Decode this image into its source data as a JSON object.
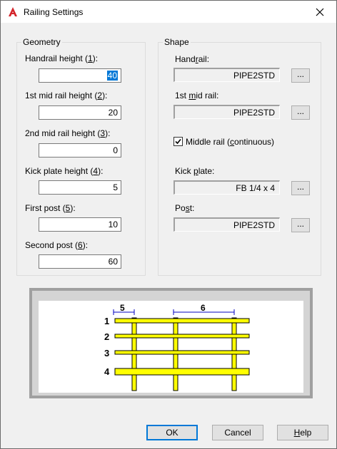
{
  "window": {
    "title": "Railing Settings"
  },
  "geometry": {
    "label": "Geometry",
    "fields": [
      {
        "pre": "Handrail height (",
        "key": "1",
        "post": "):",
        "value": "40"
      },
      {
        "pre": "1st mid rail height (",
        "key": "2",
        "post": "):",
        "value": "20"
      },
      {
        "pre": "2nd mid rail height (",
        "key": "3",
        "post": "):",
        "value": "0"
      },
      {
        "pre": "Kick plate height (",
        "key": "4",
        "post": "):",
        "value": "5"
      },
      {
        "pre": "First post (",
        "key": "5",
        "post": "):",
        "value": "10"
      },
      {
        "pre": "Second post (",
        "key": "6",
        "post": "):",
        "value": "60"
      }
    ]
  },
  "shape": {
    "label": "Shape",
    "handrail": {
      "pre": "Hand",
      "key": "r",
      "post": "ail:",
      "value": "PIPE2STD",
      "button": "..."
    },
    "mid_rail": {
      "pre": "1st ",
      "key": "m",
      "post": "id rail:",
      "value": "PIPE2STD",
      "button": "..."
    },
    "middle_continuous": {
      "pre": "Middle rail (",
      "key": "c",
      "post": "ontinuous)",
      "checked": true
    },
    "kick_plate": {
      "pre": "Kick ",
      "key": "p",
      "post": "late:",
      "value": "FB 1/4 x 4",
      "button": "..."
    },
    "post": {
      "pre": "Po",
      "key": "s",
      "post": "t:",
      "value": "PIPE2STD",
      "button": "..."
    }
  },
  "preview": {
    "rail_numbers": [
      "1",
      "2",
      "3",
      "4"
    ],
    "dim_first_post": "5",
    "dim_second_post": "6",
    "rail_color": "#ffff00"
  },
  "buttons": {
    "ok": "OK",
    "cancel": "Cancel",
    "help_key": "H",
    "help_rest": "elp"
  }
}
